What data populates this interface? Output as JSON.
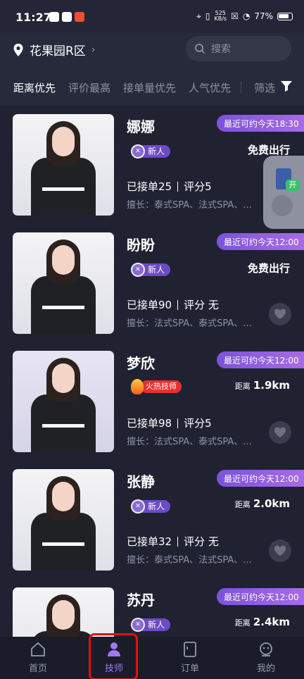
{
  "status_bar": {
    "time": "11:27",
    "network_speed_top": "525",
    "network_speed_bottom": "KB/s",
    "battery": "77%"
  },
  "header": {
    "location": "花果园R区",
    "search_placeholder": "搜索"
  },
  "tabs": [
    {
      "label": "距离优先",
      "active": true
    },
    {
      "label": "评价最高",
      "active": false
    },
    {
      "label": "接单量优先",
      "active": false
    },
    {
      "label": "人气优先",
      "active": false
    }
  ],
  "filter_label": "筛选",
  "technicians": [
    {
      "name": "娜娜",
      "avail_label": "最近可约",
      "avail_time": "今天18:30",
      "badge": "新人",
      "right_text": "免费出行",
      "orders": "已接单25",
      "rating": "评分5",
      "skills": "擅长：泰式SPA、法式SPA、..."
    },
    {
      "name": "盼盼",
      "avail_label": "最近可约",
      "avail_time": "今天12:00",
      "badge": "新人",
      "right_text": "免费出行",
      "orders": "已接单90",
      "rating": "评分 无",
      "skills": "擅长：法式SPA、泰式SPA、..."
    },
    {
      "name": "梦欣",
      "avail_label": "最近可约",
      "avail_time": "今天12:00",
      "badge": "火热技师",
      "distance_label": "距离",
      "distance": "1.9km",
      "orders": "已接单98",
      "rating": "评分5",
      "skills": "擅长：法式SPA、泰式SPA、..."
    },
    {
      "name": "张静",
      "avail_label": "最近可约",
      "avail_time": "今天12:00",
      "badge": "新人",
      "distance_label": "距离",
      "distance": "2.0km",
      "orders": "已接单32",
      "rating": "评分 无",
      "skills": "擅长：泰式SPA、法式SPA、..."
    },
    {
      "name": "苏丹",
      "avail_label": "最近可约",
      "avail_time": "今天12:00",
      "badge": "新人",
      "distance_label": "距离",
      "distance": "2.4km",
      "orders": "",
      "rating": "",
      "skills": ""
    }
  ],
  "floating_widget": {
    "label": "开"
  },
  "bottom_nav": [
    {
      "label": "首页",
      "icon": "home-icon",
      "active": false
    },
    {
      "label": "技师",
      "icon": "person-icon",
      "active": true
    },
    {
      "label": "订单",
      "icon": "order-icon",
      "active": false
    },
    {
      "label": "我的",
      "icon": "profile-icon",
      "active": false
    }
  ],
  "colors": {
    "background": "#272a3a",
    "accent": "#a078ee",
    "availability_tag": "#8b5fe0",
    "hot_tag": "#e92f2f"
  }
}
